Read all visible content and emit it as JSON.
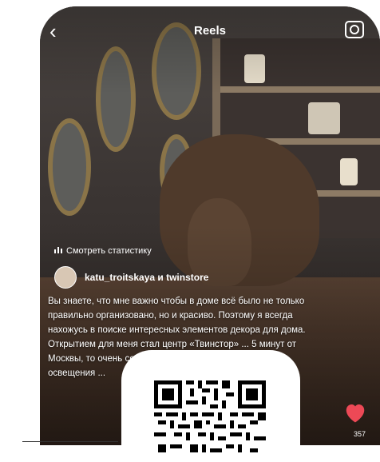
{
  "header": {
    "title": "Reels"
  },
  "post": {
    "stats_link": "Смотреть статистику",
    "username": "katu_troitskaya и twinstore",
    "caption": "Вы знаете, что мне важно чтобы в доме всё было не только правильно организовано, но и красиво. Поэтому я всегда нахожусь в поиске интересных элементов декора для дома.\nОткрытием для меня стал центр «Твинстор» ... 5 минут от Москвы, то очень сове... центре город... найдете 2 эта... освещения ..."
  },
  "actions": {
    "likes_count": "357"
  },
  "icons": {
    "back": "chevron-left-icon",
    "camera": "camera-icon",
    "stats": "bar-chart-icon",
    "like": "heart-icon"
  },
  "colors": {
    "like": "#ed4956",
    "text": "#ffffff"
  }
}
